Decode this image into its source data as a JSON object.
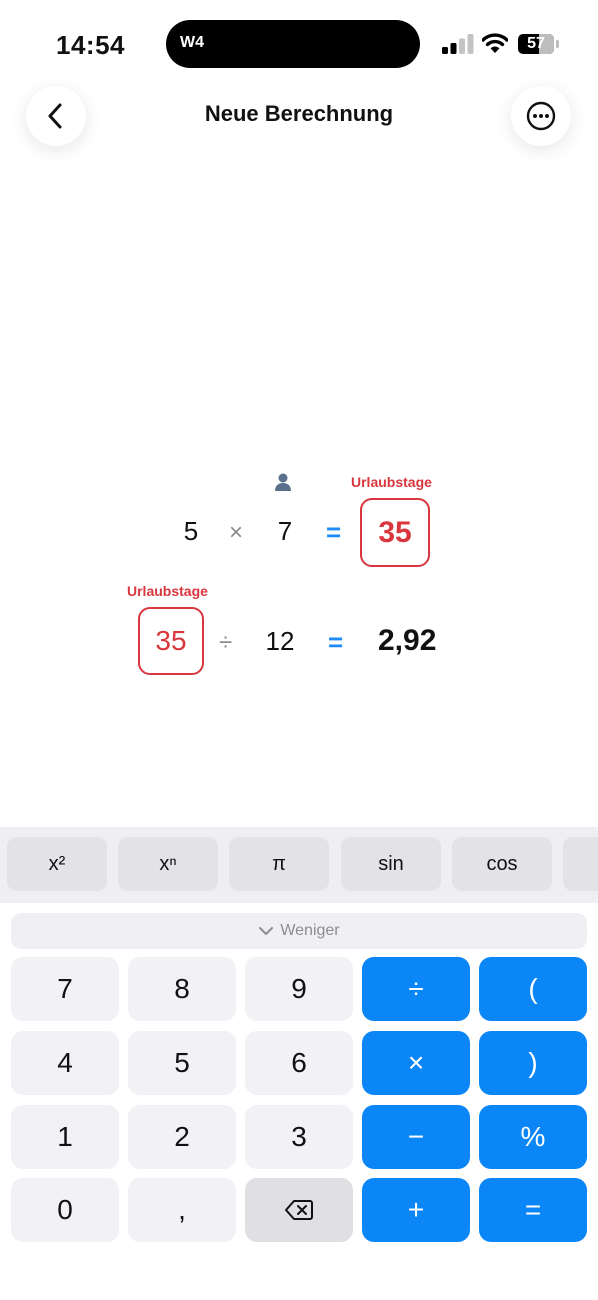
{
  "status_bar": {
    "time": "14:54",
    "island_label": "W4",
    "battery_percent": "57",
    "battery_level": 0.57
  },
  "nav": {
    "title": "Neue Berechnung",
    "back_icon": "chevron-left-icon",
    "more_icon": "ellipsis-circle-icon"
  },
  "calculation": {
    "row1": {
      "operand1": "5",
      "operator": "×",
      "operand2": "7",
      "operand2_icon": "person-icon",
      "equals": "=",
      "result_label": "Urlaubstage",
      "result": "35"
    },
    "row2": {
      "operand1_label": "Urlaubstage",
      "operand1": "35",
      "operator": "÷",
      "operand2": "12",
      "equals": "=",
      "result": "2,92"
    }
  },
  "function_keys": [
    "x²",
    "xⁿ",
    "π",
    "sin",
    "cos",
    ""
  ],
  "keypad": {
    "weniger_label": "Weniger",
    "keys": [
      "7",
      "8",
      "9",
      "÷",
      "(",
      "4",
      "5",
      "6",
      "×",
      ")",
      "1",
      "2",
      "3",
      "−",
      "%",
      "0",
      ",",
      "",
      "+",
      "="
    ]
  },
  "colors": {
    "accent_blue": "#0b86f7",
    "equals_blue": "#1d8cf8",
    "variable_red": "#d9363e"
  }
}
